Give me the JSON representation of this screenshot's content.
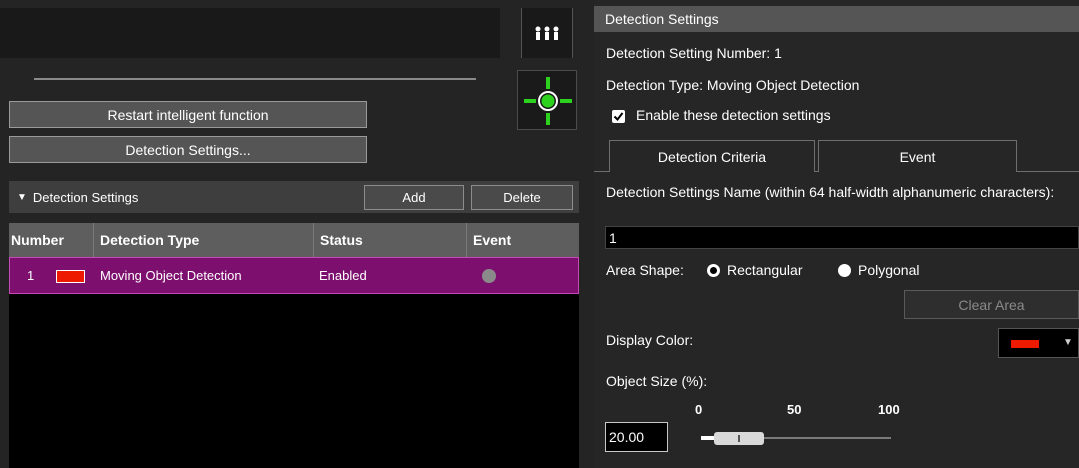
{
  "left": {
    "restart_button": "Restart intelligent function",
    "detection_settings_button": "Detection Settings...",
    "section": {
      "title": "Detection Settings",
      "add_label": "Add",
      "delete_label": "Delete"
    },
    "table": {
      "columns": [
        "Number",
        "Detection Type",
        "Status",
        "Event"
      ],
      "rows": [
        {
          "number": "1",
          "color": "#ee1a00",
          "type": "Moving Object Detection",
          "status": "Enabled"
        }
      ]
    }
  },
  "right": {
    "title": "Detection Settings",
    "setting_number": "Detection Setting Number: 1",
    "detection_type": "Detection Type: Moving Object Detection",
    "enable_label": "Enable these detection settings",
    "enable_checked": true,
    "tabs": [
      "Detection Criteria",
      "Event"
    ],
    "active_tab": "Detection Criteria",
    "name_label": "Detection Settings Name (within 64 half-width alphanumeric characters):",
    "name_value": "1",
    "area_shape_label": "Area Shape:",
    "area_options": [
      "Rectangular",
      "Polygonal"
    ],
    "area_selected": "Rectangular",
    "clear_area_label": "Clear Area",
    "display_color_label": "Display Color:",
    "display_color": "#ee1a00",
    "object_size_label": "Object Size (%):",
    "slider_ticks": [
      "0",
      "50",
      "100"
    ],
    "object_size_value": "20.00"
  },
  "colors": {
    "selected_row": "#7d0f6e",
    "target_green": "#2dd21f"
  },
  "icons": [
    "people-icon",
    "target-icon",
    "check-icon",
    "triangle-down-icon",
    "caret-down-icon"
  ]
}
